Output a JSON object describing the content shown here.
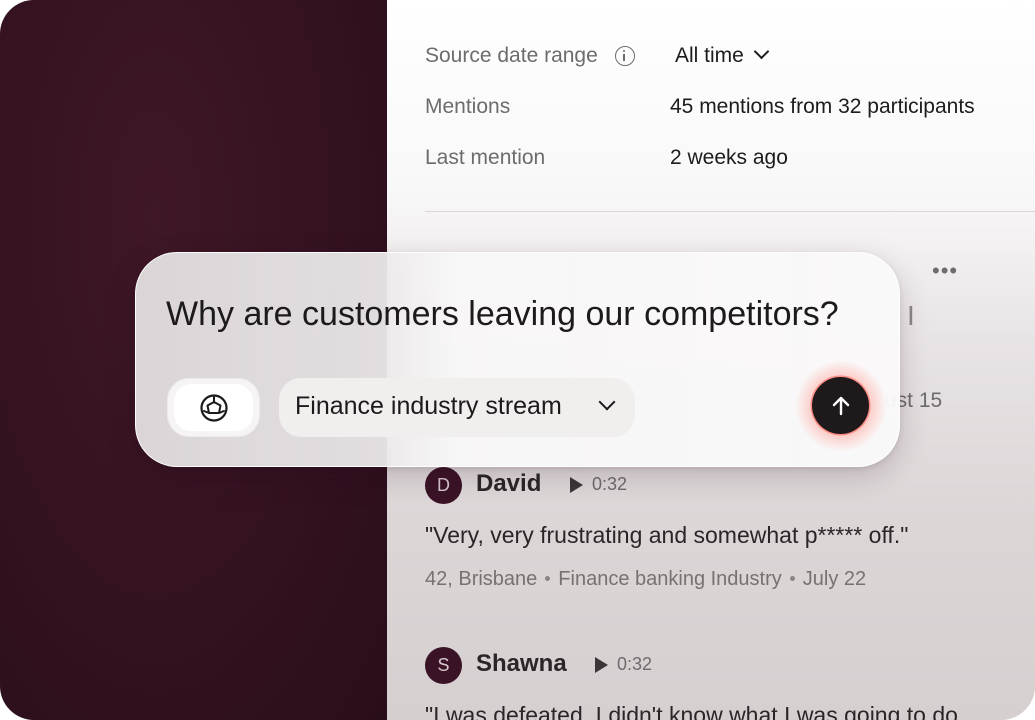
{
  "meta": {
    "source_date_range": {
      "label": "Source date range",
      "value": "All time"
    },
    "mentions": {
      "label": "Mentions",
      "value": "45 mentions from 32 participants"
    },
    "last_mention": {
      "label": "Last mention",
      "value": "2 weeks ago"
    }
  },
  "peek": {
    "date_fragment": "ust 15"
  },
  "mentions_list": [
    {
      "initial": "D",
      "name": "David",
      "duration": "0:32",
      "quote": "\"Very, very frustrating and somewhat p***** off.\"",
      "details": [
        "42, Brisbane",
        "Finance banking Industry",
        "July 22"
      ]
    },
    {
      "initial": "S",
      "name": "Shawna",
      "duration": "0:32",
      "quote": "\"I was defeated. I didn't know what I was going to do"
    }
  ],
  "ask": {
    "question": "Why are customers leaving our competitors?",
    "stream": "Finance industry stream"
  },
  "colors": {
    "left_panel": "#321120",
    "avatar": "#3a1426",
    "send_button": "#1e1a1c",
    "send_glow": "#ff7a6e"
  }
}
